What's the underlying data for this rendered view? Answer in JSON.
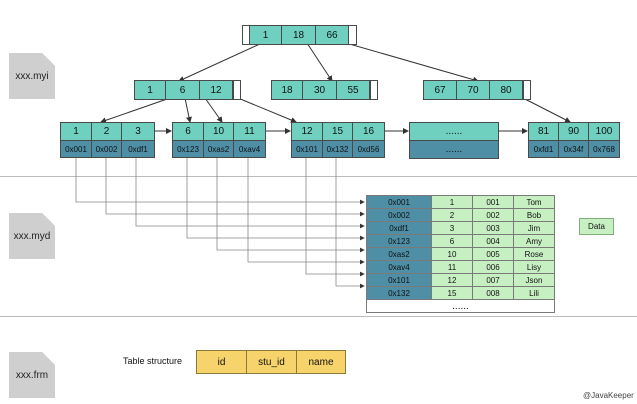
{
  "files": {
    "myi": "xxx.myi",
    "myd": "xxx.myd",
    "frm": "xxx.frm"
  },
  "root": [
    "1",
    "18",
    "66"
  ],
  "internal": [
    [
      "1",
      "6",
      "12"
    ],
    [
      "18",
      "30",
      "55"
    ],
    [
      "67",
      "70",
      "80"
    ]
  ],
  "leaves": [
    {
      "keys": [
        "1",
        "2",
        "3"
      ],
      "addrs": [
        "0x001",
        "0x002",
        "0xdf1"
      ]
    },
    {
      "keys": [
        "6",
        "10",
        "11"
      ],
      "addrs": [
        "0x123",
        "0xas2",
        "0xav4"
      ]
    },
    {
      "keys": [
        "12",
        "15",
        "16"
      ],
      "addrs": [
        "0x101",
        "0x132",
        "0xd56"
      ]
    },
    {
      "keys": [
        "81",
        "90",
        "100"
      ],
      "addrs": [
        "0xfd1",
        "0x34f",
        "0x768"
      ]
    }
  ],
  "ellipsis_top": "......",
  "ellipsis_bottom": "......",
  "data_rows": [
    [
      "0x001",
      "1",
      "001",
      "Tom"
    ],
    [
      "0x002",
      "2",
      "002",
      "Bob"
    ],
    [
      "0xdf1",
      "3",
      "003",
      "Jim"
    ],
    [
      "0x123",
      "6",
      "004",
      "Amy"
    ],
    [
      "0xas2",
      "10",
      "005",
      "Rose"
    ],
    [
      "0xav4",
      "11",
      "006",
      "Lisy"
    ],
    [
      "0x101",
      "12",
      "007",
      "Json"
    ],
    [
      "0x132",
      "15",
      "008",
      "Lili"
    ]
  ],
  "data_dots": "......",
  "data_label": "Data",
  "table_structure_label": "Table structure",
  "fields": [
    "id",
    "stu_id",
    "name"
  ],
  "watermark": "@JavaKeeper",
  "colors": {
    "key_cell": "#6fd0bf",
    "addr_cell": "#4e8fa6",
    "data_cell": "#c7f0c2",
    "field_cell": "#f7d36b",
    "file_icon": "#cfcfcf"
  }
}
